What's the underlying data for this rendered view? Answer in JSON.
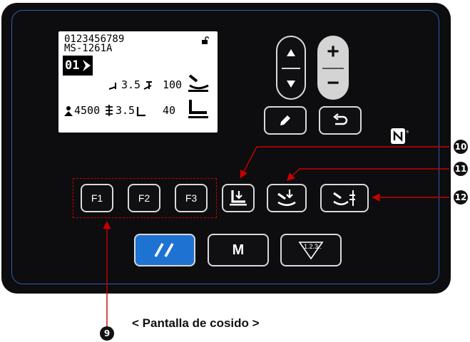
{
  "lcd": {
    "line1": "0123456789",
    "line2": "MS-1261A",
    "pattern_no": "01",
    "stitch_len_1": "3.5",
    "value_1": "100",
    "speed": "4500",
    "stitch_len_2": "3.5",
    "value_2": "40"
  },
  "buttons": {
    "plus": "+",
    "minus": "−",
    "f1": "F1",
    "f2": "F2",
    "f3": "F3",
    "mode": "M",
    "counter": "1.2.3.."
  },
  "callouts": {
    "c9": "9",
    "c10": "10",
    "c11": "11",
    "c12": "12"
  },
  "caption": "< Pantalla de cosido >",
  "colors": {
    "accent": "#1e73d2",
    "callout_line": "#c80000",
    "border": "#2f5fa8"
  }
}
